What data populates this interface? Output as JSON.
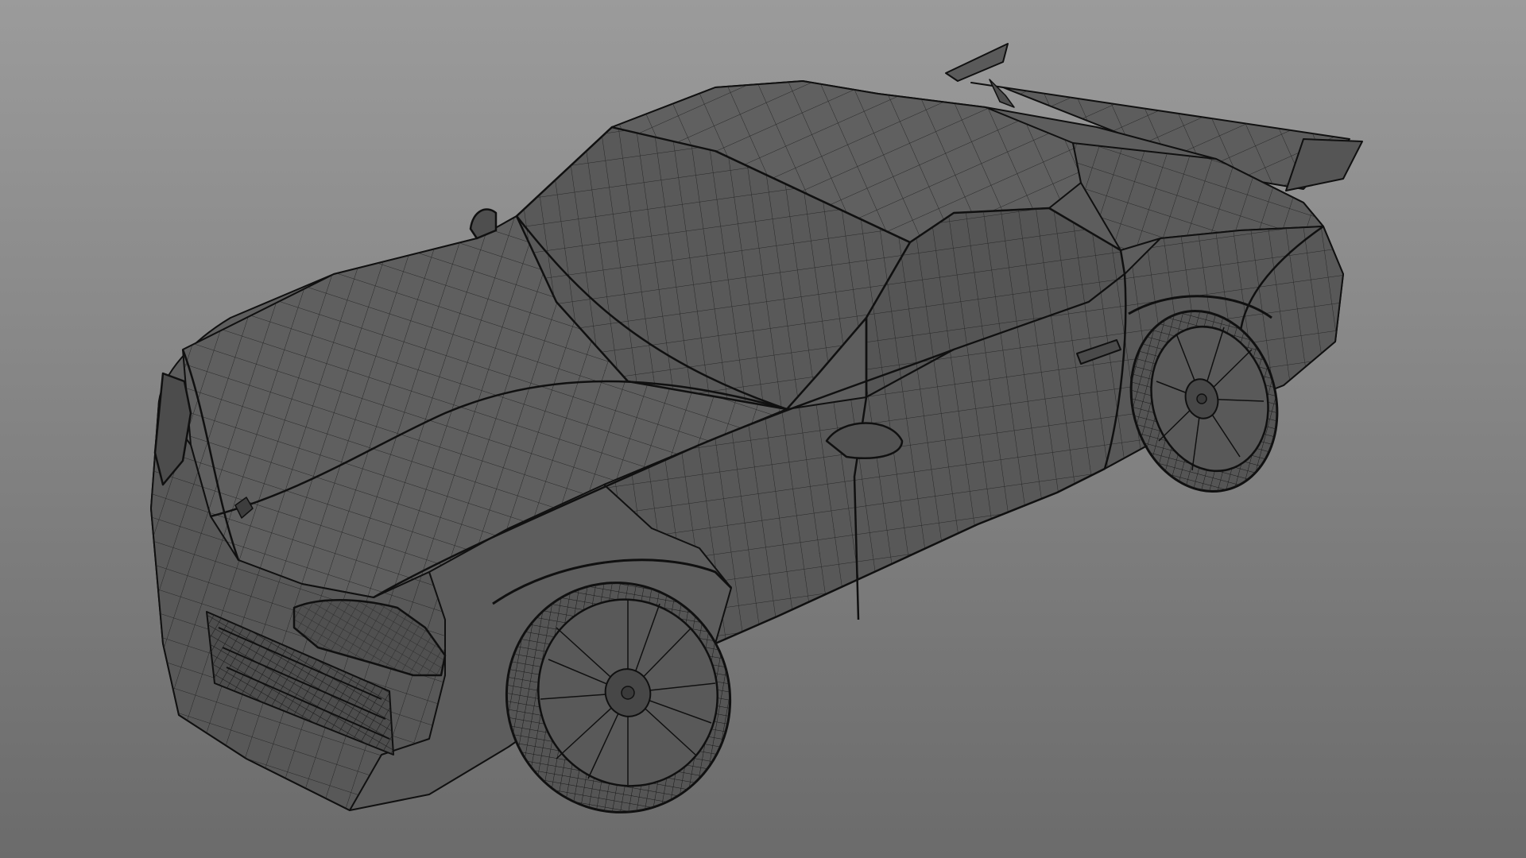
{
  "viewport": {
    "background_top": "#9b9b9b",
    "background_bottom": "#6b6b6b",
    "shading_mode": "wireframe-on-shaded",
    "subject": "sports-car-mesh",
    "mesh_fill": "#5d5d5d",
    "mesh_fill_dark": "#4f4f4f",
    "wire_color": "#1e1e1e",
    "edge_color": "#101010"
  }
}
